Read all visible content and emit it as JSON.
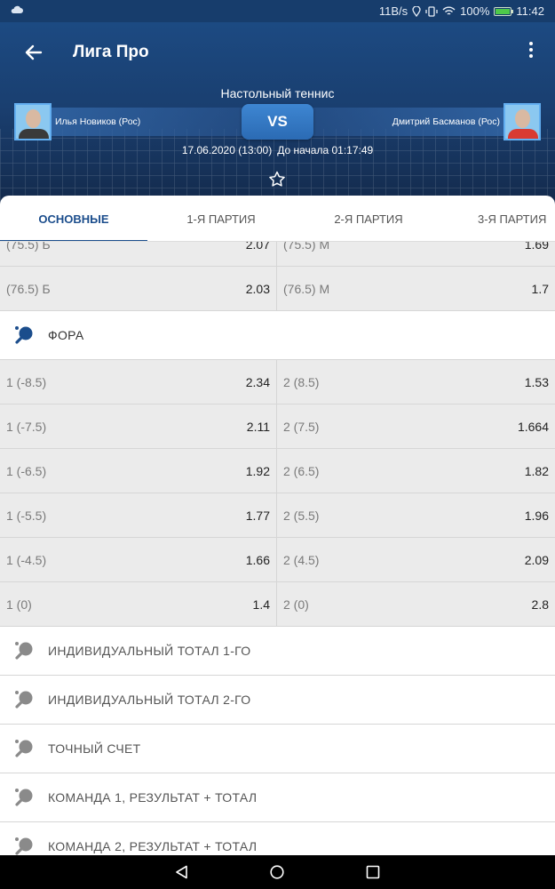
{
  "status_bar": {
    "speed": "11B/s",
    "battery": "100%",
    "time": "11:42"
  },
  "header": {
    "title": "Лига Про",
    "sport": "Настольный теннис",
    "player1": "Илья Новиков (Рос)",
    "player2": "Дмитрий Басманов (Рос)",
    "vs": "VS",
    "date": "17.06.2020 (13:00)",
    "countdown": "До начала 01:17:49"
  },
  "tabs": [
    "ОСНОВНЫЕ",
    "1-Я ПАРТИЯ",
    "2-Я ПАРТИЯ",
    "3-Я ПАРТИЯ"
  ],
  "totals_rows": [
    {
      "left_label": "(75.5) Б",
      "left_value": "2.07",
      "right_label": "(75.5) М",
      "right_value": "1.69"
    },
    {
      "left_label": "(76.5) Б",
      "left_value": "2.03",
      "right_label": "(76.5) М",
      "right_value": "1.7"
    }
  ],
  "fora": {
    "title": "ФОРА",
    "rows": [
      {
        "left_label": "1 (-8.5)",
        "left_value": "2.34",
        "right_label": "2 (8.5)",
        "right_value": "1.53"
      },
      {
        "left_label": "1 (-7.5)",
        "left_value": "2.11",
        "right_label": "2 (7.5)",
        "right_value": "1.664"
      },
      {
        "left_label": "1 (-6.5)",
        "left_value": "1.92",
        "right_label": "2 (6.5)",
        "right_value": "1.82"
      },
      {
        "left_label": "1 (-5.5)",
        "left_value": "1.77",
        "right_label": "2 (5.5)",
        "right_value": "1.96"
      },
      {
        "left_label": "1 (-4.5)",
        "left_value": "1.66",
        "right_label": "2 (4.5)",
        "right_value": "2.09"
      },
      {
        "left_label": "1 (0)",
        "left_value": "1.4",
        "right_label": "2 (0)",
        "right_value": "2.8"
      }
    ]
  },
  "collapsed_sections": [
    "ИНДИВИДУАЛЬНЫЙ ТОТАЛ 1-ГО",
    "ИНДИВИДУАЛЬНЫЙ ТОТАЛ 2-ГО",
    "ТОЧНЫЙ СЧЕТ",
    "КОМАНДА 1, РЕЗУЛЬТАТ + ТОТАЛ",
    "КОМАНДА 2, РЕЗУЛЬТАТ + ТОТАЛ"
  ],
  "colors": {
    "accent": "#1b4d8c",
    "header_bg": "#1c4a82",
    "active_icon": "#1b4d8c",
    "inactive_icon": "#8a8a8a"
  },
  "icons": {
    "section": "ping-pong-paddle-icon",
    "back": "arrow-back-icon",
    "menu": "more-vert-icon",
    "favorite": "star-outline-icon"
  }
}
